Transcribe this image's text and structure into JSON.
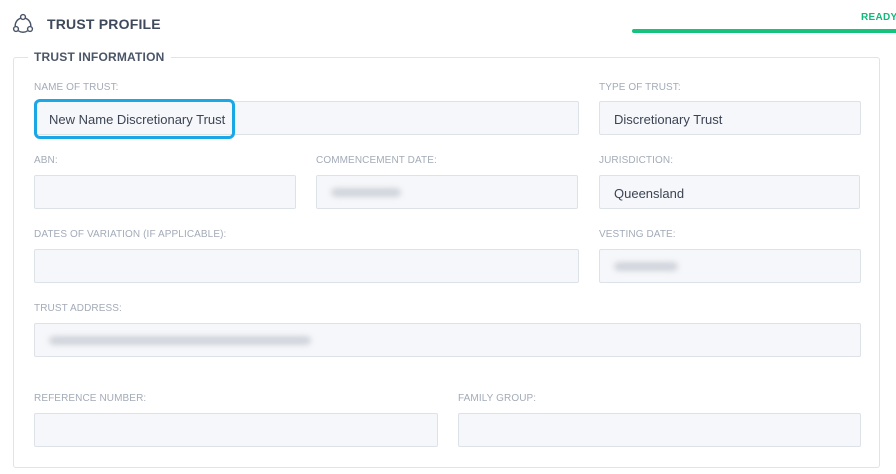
{
  "header": {
    "title": "TRUST PROFILE",
    "status": "READY:",
    "progress_percent": 100,
    "accent_color": "#16c27c"
  },
  "section": {
    "legend": "TRUST INFORMATION"
  },
  "fields": {
    "name_of_trust": {
      "label": "NAME OF TRUST:",
      "value": "New Name Discretionary Trust"
    },
    "type_of_trust": {
      "label": "TYPE OF TRUST:",
      "value": "Discretionary Trust"
    },
    "abn": {
      "label": "ABN:",
      "value": ""
    },
    "commencement_date": {
      "label": "COMMENCEMENT DATE:",
      "value": ""
    },
    "jurisdiction": {
      "label": "JURISDICTION:",
      "value": "Queensland"
    },
    "dates_of_variation": {
      "label": "DATES OF VARIATION (IF APPLICABLE):",
      "value": ""
    },
    "vesting_date": {
      "label": "VESTING DATE:",
      "value": ""
    },
    "trust_address": {
      "label": "TRUST ADDRESS:",
      "value": ""
    },
    "reference_number": {
      "label": "REFERENCE NUMBER:",
      "value": ""
    },
    "family_group": {
      "label": "FAMILY GROUP:",
      "value": ""
    }
  },
  "icons": {
    "header_icon": "trust-cycle-icon"
  },
  "highlight_color": "#1aa7e6"
}
